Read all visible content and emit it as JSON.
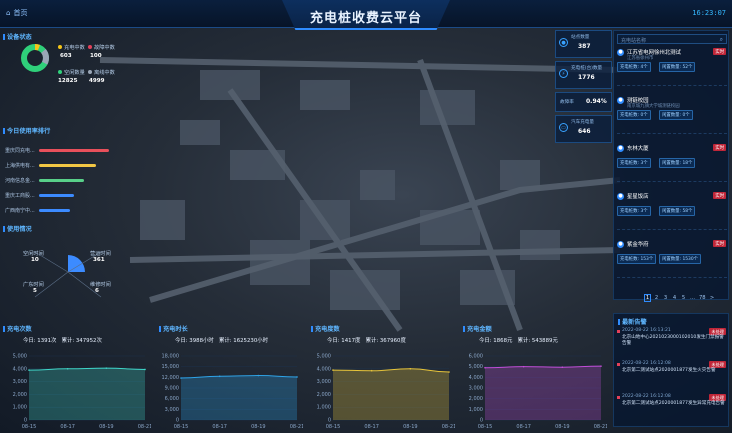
{
  "header": {
    "home_label": "首页",
    "title": "充电桩收费云平台",
    "clock": "16:23:07"
  },
  "left_panel": {
    "status_title": "设备状态",
    "status_items": [
      {
        "label": "充电中数",
        "value": "603",
        "color": "#f5c518"
      },
      {
        "label": "故障中数",
        "value": "100",
        "color": "#e3405a"
      },
      {
        "label": "空闲数量",
        "value": "12825",
        "color": "#2fd07a"
      },
      {
        "label": "离线中数",
        "value": "4999",
        "color": "#9aa6b6"
      }
    ],
    "rank_title": "今日使用率排行",
    "rank_items": [
      {
        "label": "重庆同充电...",
        "ratio": 1.0,
        "color": "#e8505b"
      },
      {
        "label": "上海供电有...",
        "ratio": 0.82,
        "color": "#f2c744"
      },
      {
        "label": "河南信息金...",
        "ratio": 0.64,
        "color": "#58d089"
      },
      {
        "label": "重庆工商股...",
        "ratio": 0.5,
        "color": "#3c8bff"
      },
      {
        "label": "广西南宁中...",
        "ratio": 0.44,
        "color": "#3c8bff"
      }
    ],
    "usage_title": "使用情况",
    "usage_left_top": {
      "label": "空闲时间",
      "value": "10"
    },
    "usage_left_bottom": {
      "label": "广东时间",
      "value": "5"
    },
    "usage_right_top": {
      "label": "营运时间",
      "value": "361"
    },
    "usage_right_bottom": {
      "label": "维修时间",
      "value": "6"
    }
  },
  "stats": [
    {
      "label": "站点数量",
      "value": "387",
      "icon": "pin-icon"
    },
    {
      "label": "充电桩(台)数量",
      "value": "1776",
      "icon": "charger-icon"
    },
    {
      "label": "故障率",
      "value": "0.94%",
      "icon": "none"
    },
    {
      "label": "汽车充电量",
      "value": "646",
      "icon": "car-icon"
    }
  ],
  "station_list": {
    "search_placeholder": "充电站名称",
    "stations": [
      {
        "name": "江苏省电网徐州北测试",
        "addr": "江苏省徐州市",
        "tag": "实时",
        "chip1": "充电桩数: 4个",
        "chip2": "闲置数量: 52个"
      },
      {
        "name": "测链校园",
        "addr": "南京城九镇大学城测链校园",
        "tag": "",
        "chip1": "充电桩数: 0个",
        "chip2": "闲置数量: 0个"
      },
      {
        "name": "东林大厦",
        "addr": "",
        "tag": "实时",
        "chip1": "充电桩数: 3个",
        "chip2": "闲置数量: 18个"
      },
      {
        "name": "星星饭店",
        "addr": "",
        "tag": "实时",
        "chip1": "充电桩数: 3个",
        "chip2": "闲置数量: 58个"
      },
      {
        "name": "紫金华府",
        "addr": "",
        "tag": "实时",
        "chip1": "充电桩数: 153个",
        "chip2": "闲置数量: 1530个"
      }
    ],
    "pages": [
      "1",
      "2",
      "3",
      "4",
      "5",
      "...",
      "78",
      ">"
    ]
  },
  "alarms": {
    "title": "最新告警",
    "items": [
      {
        "time": "2022-08-22 16:13:21",
        "text": "北京山地中心2021023000102010发生门禁报警告警",
        "tag": "未处理"
      },
      {
        "time": "2022-08-22 16:12:08",
        "text": "北京第二测试站点2020001877发生火灾告警",
        "tag": "未处理"
      },
      {
        "time": "2022-08-22 16:12:08",
        "text": "北京第二测试站点2020001877发生异常充电告警",
        "tag": "未处理"
      }
    ]
  },
  "bottom_panels": [
    {
      "title": "充电次数",
      "today": "今日: 1391次",
      "total": "累计: 347952次",
      "y_ticks": [
        "5,000",
        "4,000",
        "3,000",
        "2,000",
        "1,000",
        "0"
      ],
      "color": "#3fd6c8"
    },
    {
      "title": "充电时长",
      "today": "今日: 3988小时",
      "total": "累计: 1625230小时",
      "y_ticks": [
        "18,000",
        "15,000",
        "12,000",
        "9,000",
        "6,000",
        "3,000",
        "0"
      ],
      "color": "#2fa4e8"
    },
    {
      "title": "充电度数",
      "today": "今日: 1417度",
      "total": "累计: 367960度",
      "y_ticks": [
        "5,000",
        "4,000",
        "3,000",
        "2,000",
        "1,000",
        "0"
      ],
      "color": "#e8c53a"
    },
    {
      "title": "充电金额",
      "today": "今日: 1868元",
      "total": "累计: 543889元",
      "y_ticks": [
        "6,000",
        "5,000",
        "4,000",
        "3,000",
        "2,000",
        "1,000",
        "0"
      ],
      "color": "#c34ed8"
    }
  ],
  "chart_data": [
    {
      "type": "area",
      "title": "充电次数",
      "x": [
        "08-15",
        "08-17",
        "08-19",
        "08-21"
      ],
      "series": [
        {
          "values": [
            3900,
            4000,
            4050,
            3950
          ]
        }
      ],
      "ylim": [
        0,
        5000
      ]
    },
    {
      "type": "area",
      "title": "充电时长",
      "x": [
        "08-15",
        "08-17",
        "08-19",
        "08-21"
      ],
      "series": [
        {
          "values": [
            11800,
            12300,
            12500,
            12100
          ]
        }
      ],
      "ylim": [
        0,
        18000
      ]
    },
    {
      "type": "area",
      "title": "充电度数",
      "x": [
        "08-15",
        "08-17",
        "08-19",
        "08-21"
      ],
      "series": [
        {
          "values": [
            3900,
            3850,
            4000,
            3750
          ]
        }
      ],
      "ylim": [
        0,
        5000
      ]
    },
    {
      "type": "area",
      "title": "充电金额",
      "x": [
        "08-15",
        "08-17",
        "08-19",
        "08-21"
      ],
      "series": [
        {
          "values": [
            4900,
            5000,
            4950,
            5050
          ]
        }
      ],
      "ylim": [
        0,
        6000
      ]
    }
  ]
}
